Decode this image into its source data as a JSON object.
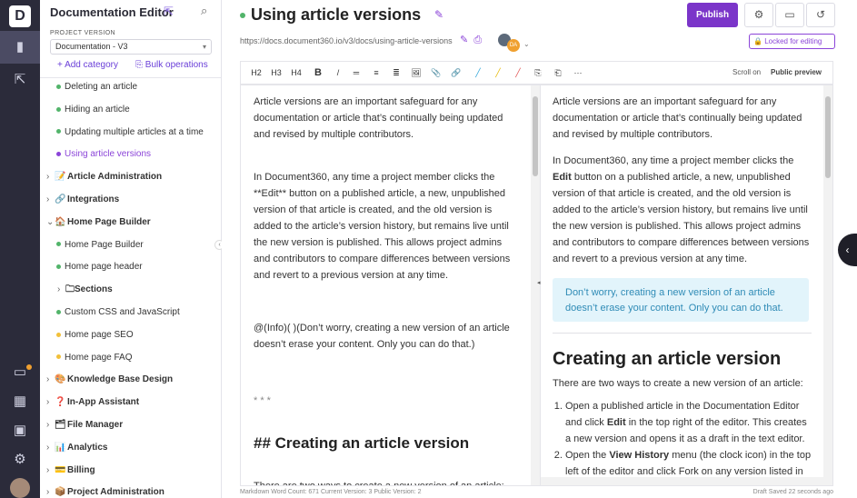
{
  "rail": {
    "logo_icon": "document360-logo",
    "items": [
      {
        "icon": "documents-icon",
        "glyph": "▮",
        "active": true
      },
      {
        "icon": "external-link-icon",
        "glyph": "⇱",
        "active": false
      }
    ],
    "bottom_items": [
      {
        "icon": "monitor-icon",
        "glyph": "▭"
      },
      {
        "icon": "analytics-icon",
        "glyph": "▦"
      },
      {
        "icon": "image-icon",
        "glyph": "▣"
      },
      {
        "icon": "settings-icon",
        "glyph": "⚙"
      }
    ],
    "notify_color": "#f0a030"
  },
  "sidebar": {
    "title": "Documentation Editor",
    "project_version_label": "PROJECT VERSION",
    "project_version_value": "Documentation - V3",
    "add_category": "+ Add category",
    "bulk_operations": "Bulk operations",
    "tree": [
      {
        "kind": "art",
        "label": "Deleting an article",
        "color": "green"
      },
      {
        "kind": "art",
        "label": "Hiding an article",
        "color": "green"
      },
      {
        "kind": "art",
        "label": "Updating multiple articles at a time",
        "color": "green"
      },
      {
        "kind": "art",
        "label": "Using article versions",
        "color": "green",
        "selected": true
      },
      {
        "kind": "cat",
        "label": "Article Administration",
        "chev": "›",
        "icon": "📝"
      },
      {
        "kind": "cat",
        "label": "Integrations",
        "chev": "›",
        "icon": "🔗"
      },
      {
        "kind": "cat",
        "label": "Home Page Builder",
        "chev": "⌄",
        "icon": "🏠"
      },
      {
        "kind": "art",
        "label": "Home Page Builder",
        "color": "green"
      },
      {
        "kind": "art",
        "label": "Home page header",
        "color": "green"
      },
      {
        "kind": "sub",
        "label": "Sections",
        "chev": "›",
        "icon": "🗀"
      },
      {
        "kind": "art",
        "label": "Custom CSS and JavaScript",
        "color": "green"
      },
      {
        "kind": "art",
        "label": "Home page SEO",
        "color": "yellow"
      },
      {
        "kind": "art",
        "label": "Home page FAQ",
        "color": "yellow"
      },
      {
        "kind": "cat",
        "label": "Knowledge Base Design",
        "chev": "›",
        "icon": "🎨"
      },
      {
        "kind": "cat",
        "label": "In-App Assistant",
        "chev": "›",
        "icon": "❓"
      },
      {
        "kind": "cat",
        "label": "File Manager",
        "chev": "›",
        "icon": "🗂"
      },
      {
        "kind": "cat",
        "label": "Analytics",
        "chev": "›",
        "icon": "📊"
      },
      {
        "kind": "cat",
        "label": "Billing",
        "chev": "›",
        "icon": "💳"
      },
      {
        "kind": "cat",
        "label": "Project Administration",
        "chev": "›",
        "icon": "📦"
      }
    ]
  },
  "header": {
    "title": "Using article versions",
    "url": "https://docs.document360.io/v3/docs/using-article-versions",
    "avatar_initials": "DA",
    "publish_label": "Publish",
    "locked_label": "Locked for editing"
  },
  "toolbar": {
    "items": [
      "H2",
      "H3",
      "H4",
      "B",
      "/",
      "═",
      "≡",
      "≣",
      "🖼",
      "📎",
      "🔗",
      "╱",
      "╱",
      "╱",
      "⎘",
      "⎗",
      "···"
    ],
    "scroll_on": "Scroll on",
    "public_preview": "Public preview"
  },
  "editor_left": {
    "p1": "Article versions are an important safeguard for any documentation or article that’s continually being updated and revised by multiple contributors.",
    "p2": "In Document360, any time a project member clicks the **Edit** button on a published article, a new, unpublished version of that article is created, and the old version is added to the article’s version history, but remains live until the new version is published. This allows project admins and contributors to compare differences between versions and revert to a previous version at any time.",
    "p3": "@(Info)( )(Don’t worry, creating a new version of an article doesn’t erase your content. Only you can do that.)",
    "p4": "* * *",
    "h2": "## Creating an article version",
    "p5": "There are two ways to create a new version of an article:"
  },
  "editor_right": {
    "p1": "Article versions are an important safeguard for any documentation or article that’s continually being updated and revised by multiple contributors.",
    "p2a": "In Document360, any time a project member clicks the ",
    "p2b": "Edit",
    "p2c": " button on a published article, a new, unpublished version of that article is created, and the old version is added to the article’s version history, but remains live until the new version is published. This allows project admins and contributors to compare differences between versions and revert to a previous version at any time.",
    "callout": "Don’t worry, creating a new version of an article doesn’t erase your content. Only you can do that.",
    "h2": "Creating an article version",
    "p3": "There are two ways to create a new version of an article:",
    "step1a": "Open a published article in the Documentation Editor and click ",
    "step1b": "Edit",
    "step1c": " in the top right of the editor. This creates a new version and opens it as a draft in the text editor.",
    "step2a": "Open the ",
    "step2b": "View History",
    "step2c": " menu (the clock icon) in the top left of the editor and click Fork on any version listed in"
  },
  "statusbar": {
    "left": "Markdown  Word Count: 671  Current Version: 3  Public Version: 2",
    "right": "Draft Saved 22 seconds ago"
  }
}
